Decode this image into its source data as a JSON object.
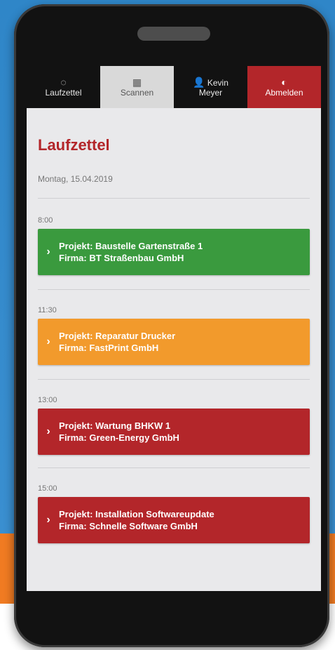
{
  "nav": {
    "items": [
      {
        "icon": "compass-icon",
        "glyph": "◌",
        "label": "Laufzettel",
        "label2": ""
      },
      {
        "icon": "qr-code-icon",
        "glyph": "▦",
        "label": "Scannen",
        "label2": ""
      },
      {
        "icon": "user-icon",
        "glyph": "👤",
        "label": "Kevin",
        "label2": "Meyer"
      },
      {
        "icon": "power-icon",
        "glyph": "◐",
        "label": "Abmelden",
        "label2": ""
      }
    ]
  },
  "page": {
    "title": "Laufzettel",
    "date": "Montag, 15.04.2019"
  },
  "entries": [
    {
      "time": "8:00",
      "project": "Projekt: Baustelle Gartenstraße 1",
      "company": "Firma: BT Straßenbau GmbH",
      "status_color": "#3a9a3e"
    },
    {
      "time": "11:30",
      "project": "Projekt: Reparatur Drucker",
      "company": "Firma: FastPrint GmbH",
      "status_color": "#f29a2c"
    },
    {
      "time": "13:00",
      "project": "Projekt: Wartung BHKW 1",
      "company": "Firma: Green-Energy GmbH",
      "status_color": "#b3262a"
    },
    {
      "time": "15:00",
      "project": "Projekt: Installation Softwareupdate",
      "company": "Firma: Schnelle Software GmbH",
      "status_color": "#b3262a"
    }
  ],
  "colors": {
    "accent": "#b3262a",
    "green": "#3a9a3e",
    "orange": "#f29a2c"
  }
}
